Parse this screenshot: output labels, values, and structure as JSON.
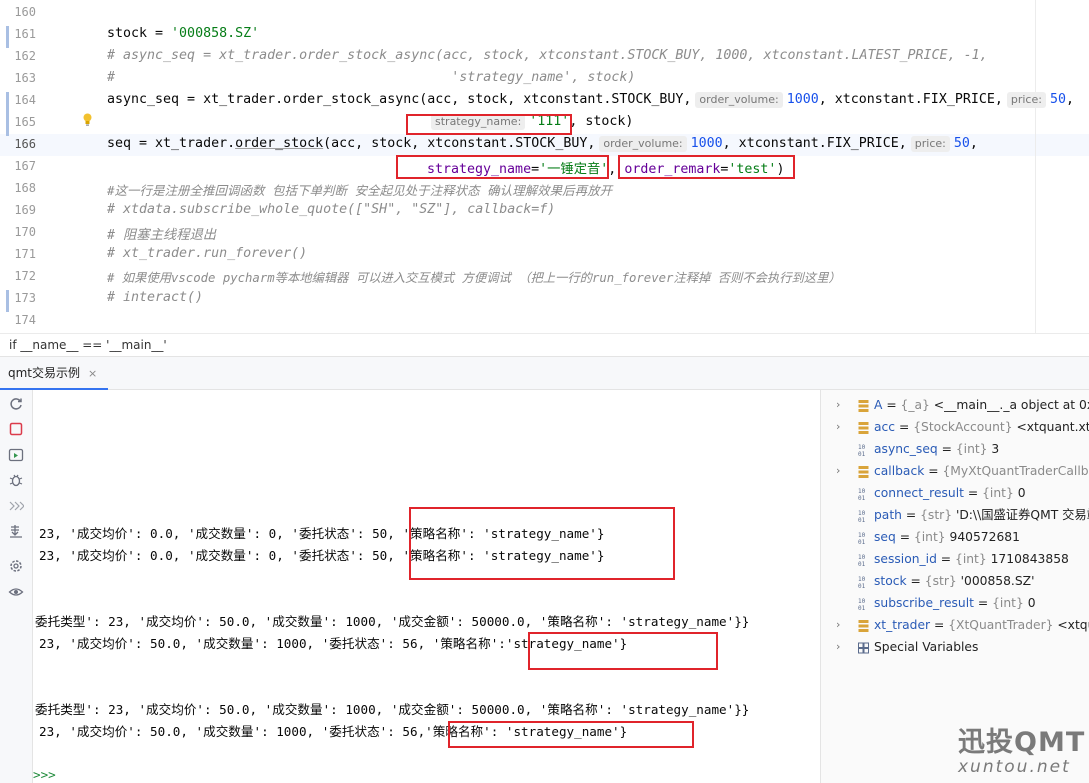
{
  "editor": {
    "line_numbers": [
      "160",
      "161",
      "162",
      "163",
      "164",
      "165",
      "166",
      "167",
      "168",
      "169",
      "170",
      "171",
      "172",
      "173",
      "174"
    ],
    "l161": {
      "a": "stock = ",
      "b": "'000858.SZ'"
    },
    "l162": "# async_seq = xt_trader.order_stock_async(acc, stock, xtconstant.STOCK_BUY, 1000, xtconstant.LATEST_PRICE, -1,",
    "l163": "#                                          'strategy_name', stock)",
    "l164": {
      "a": "async_seq = xt_trader.order_stock_async(acc, stock, xtconstant.STOCK_BUY,",
      "hint1": "order_volume:",
      "n1": "1000",
      "b": ", xtconstant.FIX_PRICE,",
      "hint2": "price:",
      "n2": "50",
      "c": ","
    },
    "l165": {
      "hint": "strategy_name:",
      "s": "'111'",
      "b": ", stock)"
    },
    "l166": {
      "a": "seq = xt_trader.",
      "fn": "order_stock",
      "b": "(acc, stock, xtconstant.STOCK_BUY,",
      "hint1": "order_volume:",
      "n1": "1000",
      "c": ", xtconstant.FIX_PRICE,",
      "hint2": "price:",
      "n2": "50",
      "d": ","
    },
    "l167": {
      "k1": "strategy_name",
      "eq1": "=",
      "s1": "'一锤定音'",
      "sep": ", ",
      "k2": "order_remark",
      "eq2": "=",
      "s2": "'test'",
      "end": ")"
    },
    "l168": "#这一行是注册全推回调函数 包括下单判断 安全起见处于注释状态 确认理解效果后再放开",
    "l169": "# xtdata.subscribe_whole_quote([\"SH\", \"SZ\"], callback=f)",
    "l170": "# 阻塞主线程退出",
    "l171": "# xt_trader.run_forever()",
    "l172": "# 如果使用vscode pycharm等本地编辑器 可以进入交互模式 方便调试 （把上一行的run_forever注释掉 否则不会执行到这里）",
    "l173": "# interact()"
  },
  "breadcrumb": "if __name__ == '__main__'",
  "run_tab": {
    "label": "qmt交易示例",
    "close": "×"
  },
  "console": {
    "line1a": "23, '成交均价': 0.0, '成交数量': 0, '委托状态': 50,",
    "line1b": "'策略名称': 'strategy_name'}",
    "line2a": "23, '成交均价': 0.0, '成交数量': 0, '委托状态': 50,",
    "line2b": "'策略名称': 'strategy_name'}",
    "line3": "委托类型': 23, '成交均价': 50.0, '成交数量': 1000, '成交金额': 50000.0, '策略名称': 'strategy_name'}}",
    "line4a": "23, '成交均价': 50.0, '成交数量': 1000, '委托状态': 56, '策略名称':",
    "line4b": "'strategy_name'}",
    "line5": "委托类型': 23, '成交均价': 50.0, '成交数量': 1000, '成交金额': 50000.0, '策略名称': 'strategy_name'}}",
    "line6a": "23, '成交均价': 50.0, '成交数量': 1000, '委托状态': 56,",
    "line6b": "'策略名称': 'strategy_name'}",
    "prompt": ">>>"
  },
  "variables": [
    {
      "name": "A",
      "type": "{_a}",
      "value": "<__main__._a object at 0x0",
      "expandable": true,
      "icon": "object-icon"
    },
    {
      "name": "acc",
      "type": "{StockAccount}",
      "value": "<xtquant.xtt",
      "expandable": true,
      "icon": "object-icon"
    },
    {
      "name": "async_seq",
      "type": "{int}",
      "value": "3",
      "expandable": false,
      "icon": "int-icon"
    },
    {
      "name": "callback",
      "type": "{MyXtQuantTraderCallba",
      "value": "",
      "expandable": true,
      "icon": "object-icon"
    },
    {
      "name": "connect_result",
      "type": "{int}",
      "value": "0",
      "expandable": false,
      "icon": "int-icon"
    },
    {
      "name": "path",
      "type": "{str}",
      "value": "'D:\\\\国盛证券QMT 交易端",
      "expandable": false,
      "icon": "str-icon"
    },
    {
      "name": "seq",
      "type": "{int}",
      "value": "940572681",
      "expandable": false,
      "icon": "int-icon"
    },
    {
      "name": "session_id",
      "type": "{int}",
      "value": "1710843858",
      "expandable": false,
      "icon": "int-icon"
    },
    {
      "name": "stock",
      "type": "{str}",
      "value": "'000858.SZ'",
      "expandable": false,
      "icon": "str-icon"
    },
    {
      "name": "subscribe_result",
      "type": "{int}",
      "value": "0",
      "expandable": false,
      "icon": "int-icon"
    },
    {
      "name": "xt_trader",
      "type": "{XtQuantTrader}",
      "value": "<xtqu",
      "expandable": true,
      "icon": "object-icon"
    }
  ],
  "special_variables": "Special Variables",
  "watermark": {
    "line1": "迅投QMT",
    "line2": "xuntou.net"
  },
  "colors": {
    "annotation": "#e0242b",
    "accent": "#3574f0"
  }
}
